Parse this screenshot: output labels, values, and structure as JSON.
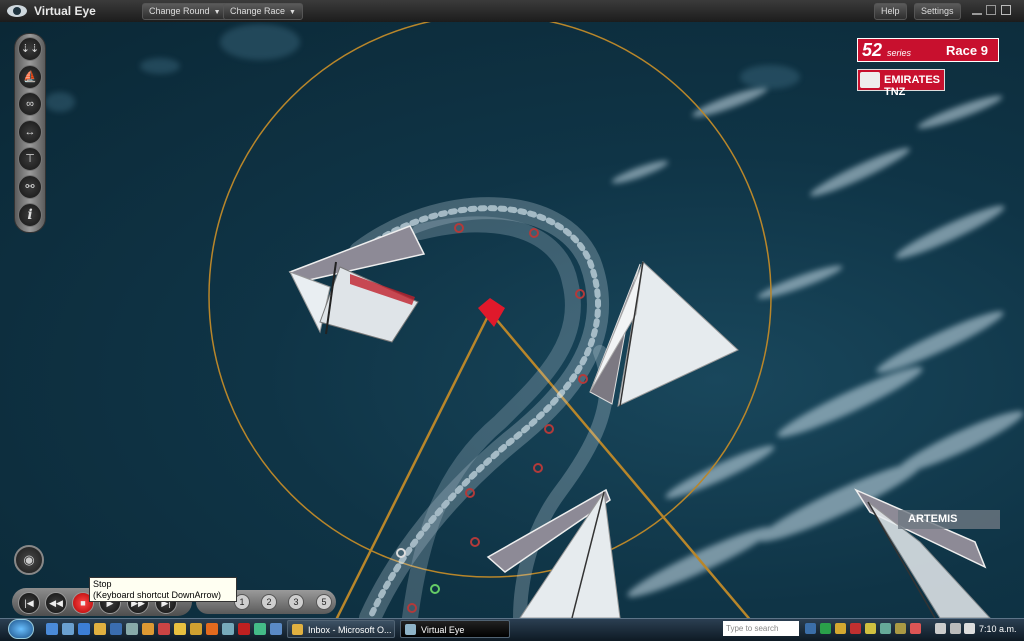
{
  "window": {
    "title": "Virtual Eye",
    "menu_buttons": [
      "Change Round",
      "Change Race"
    ],
    "right_buttons": [
      "Help",
      "Settings"
    ]
  },
  "overlay": {
    "series_number": "52",
    "series_word": "series",
    "race_label": "Race 9",
    "leading_boat": "EMIRATES TNZ",
    "boat_label": "ARTEMIS"
  },
  "tooltip": {
    "line1": "Stop",
    "line2": "(Keyboard shortcut DownArrow)"
  },
  "playback": {
    "speeds": [
      "1",
      "2",
      "3",
      "5"
    ]
  },
  "taskbar": {
    "tasks": [
      "Inbox - Microsoft O...",
      "Virtual Eye"
    ],
    "search_placeholder": "Type to search",
    "clock": "7:10 a.m."
  },
  "colors": {
    "accent_red": "#c8102e",
    "laylines": "#b8862a"
  }
}
